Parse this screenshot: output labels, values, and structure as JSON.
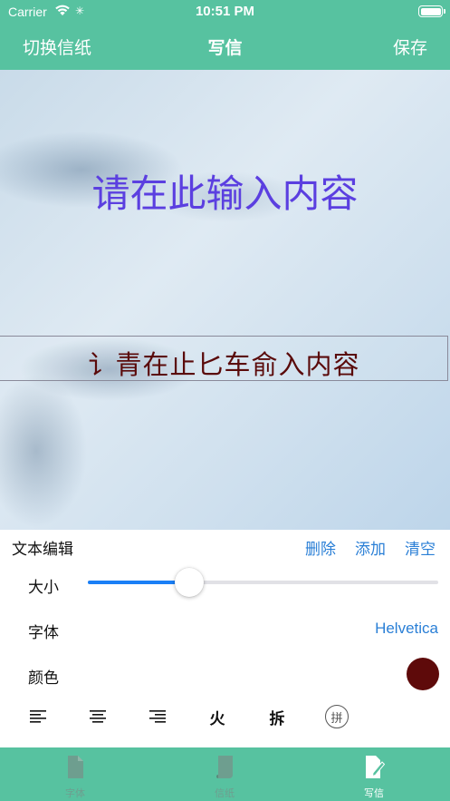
{
  "status_bar": {
    "carrier": "Carrier",
    "time": "10:51 PM"
  },
  "nav": {
    "left_label": "切换信纸",
    "title": "写信",
    "right_label": "保存"
  },
  "canvas": {
    "placeholder": "请在此输入内容",
    "text_box_content": "讠青在止匕车俞入内容",
    "text_color": "#5a0a0a",
    "placeholder_color": "#5b3fe0"
  },
  "editor": {
    "title": "文本编辑",
    "actions": {
      "delete": "删除",
      "add": "添加",
      "clear": "清空"
    },
    "size_label": "大小",
    "size_fraction": 0.29,
    "font_label": "字体",
    "font_value": "Helvetica",
    "color_label": "颜色",
    "color_value": "#5e0a0a",
    "tools": {
      "fire_label": "火",
      "split_label": "拆",
      "pinyin_label": "拼"
    }
  },
  "tabs": [
    {
      "label": "字体",
      "icon": "document-icon",
      "active": false
    },
    {
      "label": "信纸",
      "icon": "paper-icon",
      "active": false
    },
    {
      "label": "写信",
      "icon": "write-icon",
      "active": true
    }
  ],
  "colors": {
    "brand": "#57c2a0",
    "link": "#2a7fd6",
    "slider_fill": "#1a7ff6"
  }
}
